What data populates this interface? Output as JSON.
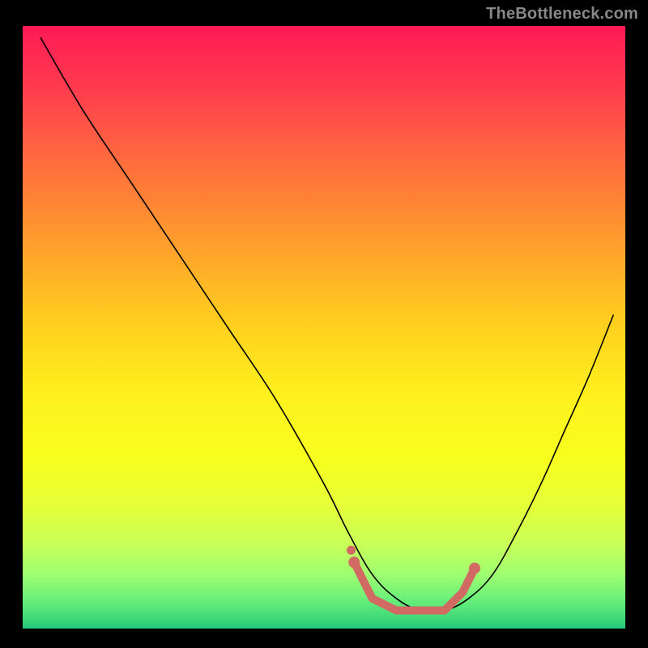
{
  "watermark": "TheBottleneck.com",
  "chart_data": {
    "type": "line",
    "title": "",
    "xlabel": "",
    "ylabel": "",
    "xlim": [
      0,
      100
    ],
    "ylim": [
      0,
      100
    ],
    "grid": false,
    "legend": false,
    "background_gradient": {
      "stops": [
        {
          "offset": 0.0,
          "color": "#ff1a55"
        },
        {
          "offset": 0.1,
          "color": "#ff3a4f"
        },
        {
          "offset": 0.22,
          "color": "#ff6a3e"
        },
        {
          "offset": 0.35,
          "color": "#ff9a2e"
        },
        {
          "offset": 0.5,
          "color": "#ffd21e"
        },
        {
          "offset": 0.62,
          "color": "#fff21e"
        },
        {
          "offset": 0.72,
          "color": "#f7ff1e"
        },
        {
          "offset": 0.8,
          "color": "#e4ff3a"
        },
        {
          "offset": 0.86,
          "color": "#c8ff58"
        },
        {
          "offset": 0.91,
          "color": "#9eff70"
        },
        {
          "offset": 0.95,
          "color": "#6cf07a"
        },
        {
          "offset": 0.985,
          "color": "#3dd97a"
        },
        {
          "offset": 1.0,
          "color": "#20c97a"
        }
      ]
    },
    "series": [
      {
        "name": "curve",
        "x": [
          3,
          10,
          18,
          26,
          34,
          42,
          50,
          54,
          58,
          62,
          66,
          70,
          74,
          78,
          82,
          86,
          90,
          94,
          98
        ],
        "y": [
          98,
          86,
          74,
          62,
          50,
          38,
          24,
          16,
          9,
          5,
          3,
          3,
          5,
          9,
          16,
          24,
          33,
          42,
          52
        ]
      }
    ],
    "markers": {
      "name": "highlight-segment",
      "color": "#d16a62",
      "points": [
        {
          "x": 55,
          "y": 11
        },
        {
          "x": 58,
          "y": 5
        },
        {
          "x": 62,
          "y": 3
        },
        {
          "x": 66,
          "y": 3
        },
        {
          "x": 70,
          "y": 3
        },
        {
          "x": 73,
          "y": 6
        },
        {
          "x": 75,
          "y": 10
        }
      ]
    }
  }
}
